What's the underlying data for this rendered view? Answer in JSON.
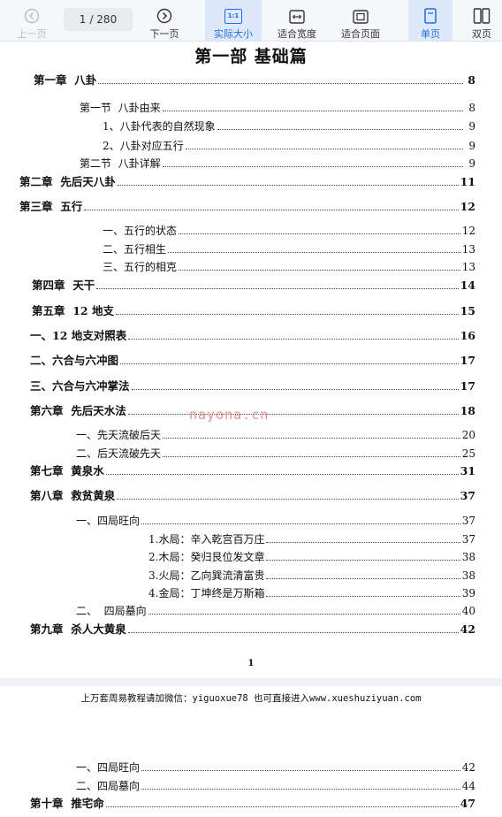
{
  "toolbar": {
    "prev_label": "上一页",
    "current_page": "1",
    "total_pages": "/ 280",
    "next_label": "下一页",
    "actual_size_label": "实际大小",
    "fit_width_label": "适合宽度",
    "fit_page_label": "适合页面",
    "single_page_label": "单页",
    "double_page_label": "双页",
    "actual_size_icon_text": "1:1"
  },
  "page1": {
    "title": "第一部 基础篇",
    "entries": [
      {
        "text": "第一章  八卦",
        "page": "8"
      },
      {
        "text": "第一节  八卦由来",
        "page": "8"
      },
      {
        "text": "1、八卦代表的自然现象",
        "page": "9"
      },
      {
        "text": "2、八卦对应五行",
        "page": "9"
      },
      {
        "text": "第二节  八卦详解",
        "page": "9"
      },
      {
        "text": "第二章  先后天八卦",
        "page": "11"
      },
      {
        "text": "第三章  五行",
        "page": "12"
      },
      {
        "text": "一、五行的状态",
        "page": "12"
      },
      {
        "text": "二、五行相生",
        "page": "13"
      },
      {
        "text": "三、五行的相克",
        "page": "13"
      },
      {
        "text": "第四章  天干",
        "page": "14"
      },
      {
        "text": "第五章  12 地支",
        "page": "15"
      },
      {
        "text": "一、12 地支对照表",
        "page": "16"
      },
      {
        "text": "二、六合与六冲图",
        "page": "17"
      },
      {
        "text": "三、六合与六冲掌法",
        "page": "17"
      },
      {
        "text": "第六章  先后天水法",
        "page": "18"
      },
      {
        "text": "一、先天流破后天",
        "page": "20"
      },
      {
        "text": "二、后天流破先天",
        "page": "25"
      },
      {
        "text": "第七章  黄泉水",
        "page": "31"
      },
      {
        "text": "第八章  救贫黄泉",
        "page": "37"
      },
      {
        "text": "一、四局旺向",
        "page": "37"
      },
      {
        "text": "1.水局：辛入乾宫百万庄",
        "page": "37"
      },
      {
        "text": "2.木局：癸归艮位发文章",
        "page": "38"
      },
      {
        "text": "3.火局：乙向巽流清富贵",
        "page": "38"
      },
      {
        "text": "4.金局：丁坤终是万斯箱",
        "page": "39"
      },
      {
        "text": "二、  四局墓向",
        "page": "40"
      },
      {
        "text": "第九章  杀人大黄泉",
        "page": "42"
      }
    ],
    "page_number": "1",
    "watermark": "nayona.cn"
  },
  "footer_note": "上万套周易教程请加微信：yiguoxue78  也可直接进入www.xueshuziyuan.com",
  "page2": {
    "entries": [
      {
        "text": "一、四局旺向",
        "page": "42"
      },
      {
        "text": "二、四局墓向",
        "page": "44"
      },
      {
        "text": "第十章  推宅命",
        "page": "47"
      }
    ]
  }
}
